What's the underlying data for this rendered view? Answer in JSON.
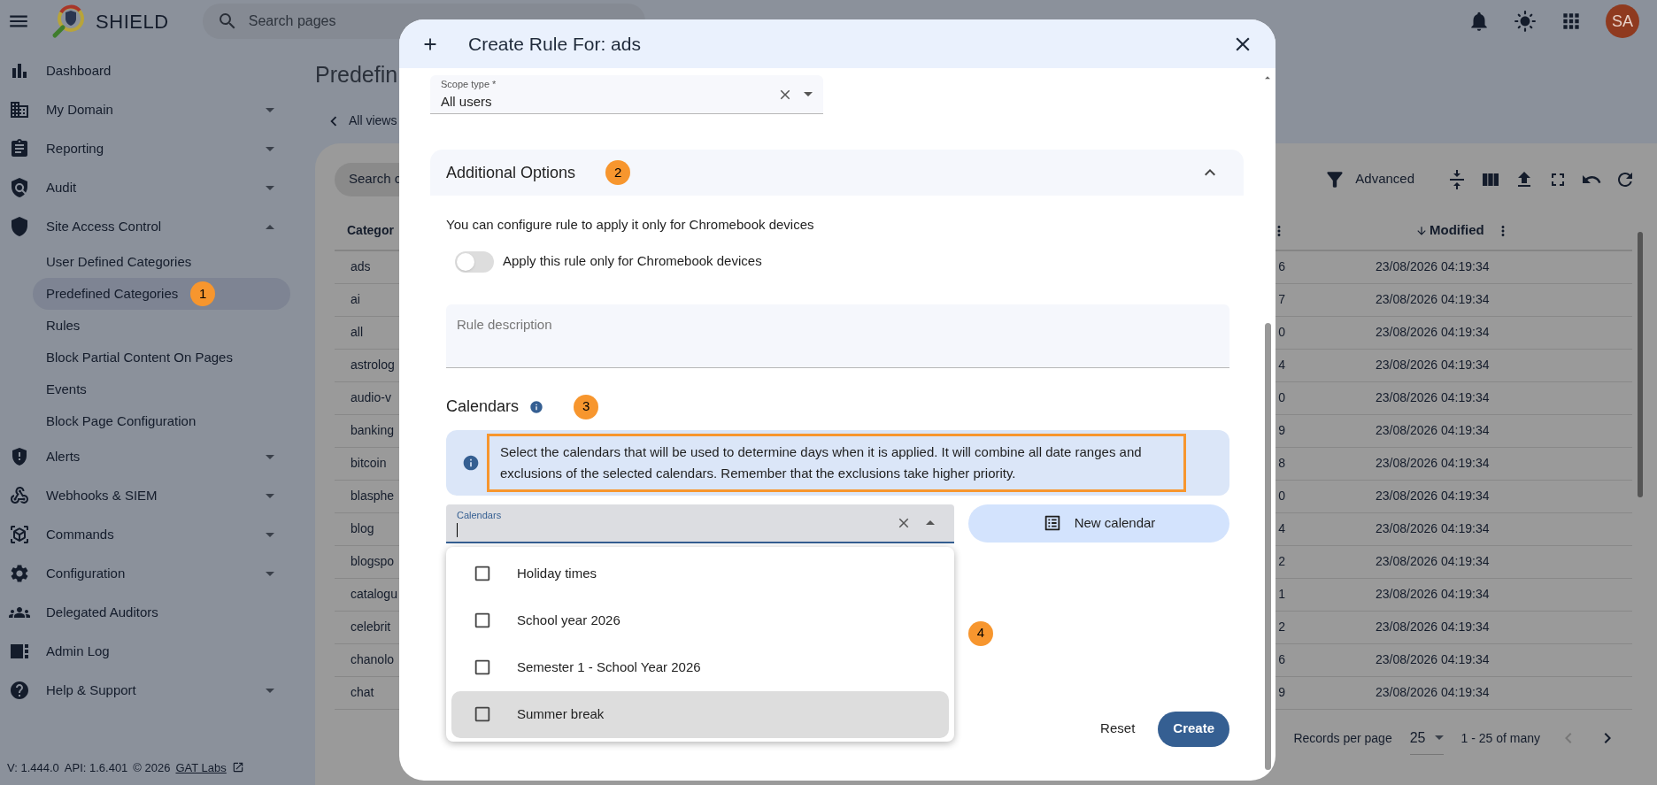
{
  "top_bar": {
    "app_name": "SHIELD",
    "search": {
      "placeholder": "Search pages"
    },
    "avatar": "SA"
  },
  "sidebar": {
    "items": [
      {
        "label": "Dashboard",
        "kind": "link"
      },
      {
        "label": "My Domain",
        "kind": "group",
        "expanded": false
      },
      {
        "label": "Reporting",
        "kind": "group",
        "expanded": false
      },
      {
        "label": "Audit",
        "kind": "group",
        "expanded": false
      },
      {
        "label": "Site Access Control",
        "kind": "group",
        "expanded": true,
        "children": [
          {
            "label": "User Defined Categories",
            "selected": false
          },
          {
            "label": "Predefined Categories",
            "selected": true,
            "badge": "1"
          },
          {
            "label": "Rules",
            "selected": false
          },
          {
            "label": "Block Partial Content On Pages",
            "selected": false
          },
          {
            "label": "Events",
            "selected": false
          },
          {
            "label": "Block Page Configuration",
            "selected": false
          }
        ]
      },
      {
        "label": "Alerts",
        "kind": "group",
        "expanded": false
      },
      {
        "label": "Webhooks & SIEM",
        "kind": "group",
        "expanded": false
      },
      {
        "label": "Commands",
        "kind": "group",
        "expanded": false
      },
      {
        "label": "Configuration",
        "kind": "group",
        "expanded": false
      },
      {
        "label": "Delegated Auditors",
        "kind": "link"
      },
      {
        "label": "Admin Log",
        "kind": "link"
      },
      {
        "label": "Help & Support",
        "kind": "group",
        "expanded": false
      }
    ],
    "footer": {
      "version": "V: 1.444.0",
      "api": "API: 1.6.401",
      "copyright": "© 2026",
      "link": "GAT Labs"
    }
  },
  "main": {
    "page_title": "Predefin",
    "back_link": "All views",
    "search_placeholder": "Search c",
    "advanced": "Advanced",
    "table": {
      "columns": [
        {
          "label": "Categor"
        },
        {
          "label": "Modified",
          "sorted": true
        }
      ],
      "rows": [
        {
          "category": "ads",
          "column_2": "6",
          "modified": "23/08/2026 04:19:34"
        },
        {
          "category": "ai",
          "column_2": "7",
          "modified": "23/08/2026 04:19:34"
        },
        {
          "category": "all",
          "column_2": "0",
          "modified": "23/08/2026 04:19:34"
        },
        {
          "category": "astrolog",
          "column_2": "4",
          "modified": "23/08/2026 04:19:34"
        },
        {
          "category": "audio-v",
          "column_2": "0",
          "modified": "23/08/2026 04:19:34"
        },
        {
          "category": "banking",
          "column_2": "9",
          "modified": "23/08/2026 04:19:34"
        },
        {
          "category": "bitcoin",
          "column_2": "8",
          "modified": "23/08/2026 04:19:34"
        },
        {
          "category": "blasphe",
          "column_2": "0",
          "modified": "23/08/2026 04:19:34"
        },
        {
          "category": "blog",
          "column_2": "4",
          "modified": "23/08/2026 04:19:34"
        },
        {
          "category": "blogspo",
          "column_2": "2",
          "modified": "23/08/2026 04:19:34"
        },
        {
          "category": "catalogu",
          "column_2": "1",
          "modified": "23/08/2026 04:19:34"
        },
        {
          "category": "celebrit",
          "column_2": "2",
          "modified": "23/08/2026 04:19:34"
        },
        {
          "category": "chanolo",
          "column_2": "6",
          "modified": "23/08/2026 04:19:34"
        },
        {
          "category": "chat",
          "column_2": "9",
          "modified": "23/08/2026 04:19:34"
        }
      ]
    },
    "pagination": {
      "label": "Records per page",
      "per_page": "25",
      "range": "1 - 25 of many"
    }
  },
  "dialog": {
    "title": "Create Rule For: ads",
    "scope_field": {
      "label": "Scope type *",
      "value": "All users"
    },
    "accordion": {
      "title": "Additional Options",
      "expanded": true,
      "badge": "2"
    },
    "chromebook_note": "You can configure rule to apply it only for Chromebook devices",
    "toggle": {
      "label": "Apply this rule only for Chromebook devices",
      "on": false
    },
    "description": {
      "placeholder": "Rule description"
    },
    "calendars": {
      "heading": "Calendars",
      "badge": "3",
      "info": "Select the calendars that will be used to determine days when it is applied. It will combine all date ranges and exclusions of the selected calendars. Remember that the exclusions take higher priority.",
      "info_highlighted": true,
      "field": {
        "label": "Calendars",
        "open": true
      },
      "new_button": "New calendar",
      "options": [
        {
          "label": "Holiday times",
          "checked": false,
          "highlighted": false
        },
        {
          "label": "School year 2026",
          "checked": false,
          "highlighted": false
        },
        {
          "label": "Semester 1 - School Year 2026",
          "checked": false,
          "highlighted": false
        },
        {
          "label": "Summer break",
          "checked": false,
          "highlighted": true
        }
      ],
      "options_badge": "4"
    },
    "actions": [
      {
        "label": "Reset",
        "kind": "text"
      },
      {
        "label": "Create",
        "kind": "filled"
      }
    ]
  }
}
